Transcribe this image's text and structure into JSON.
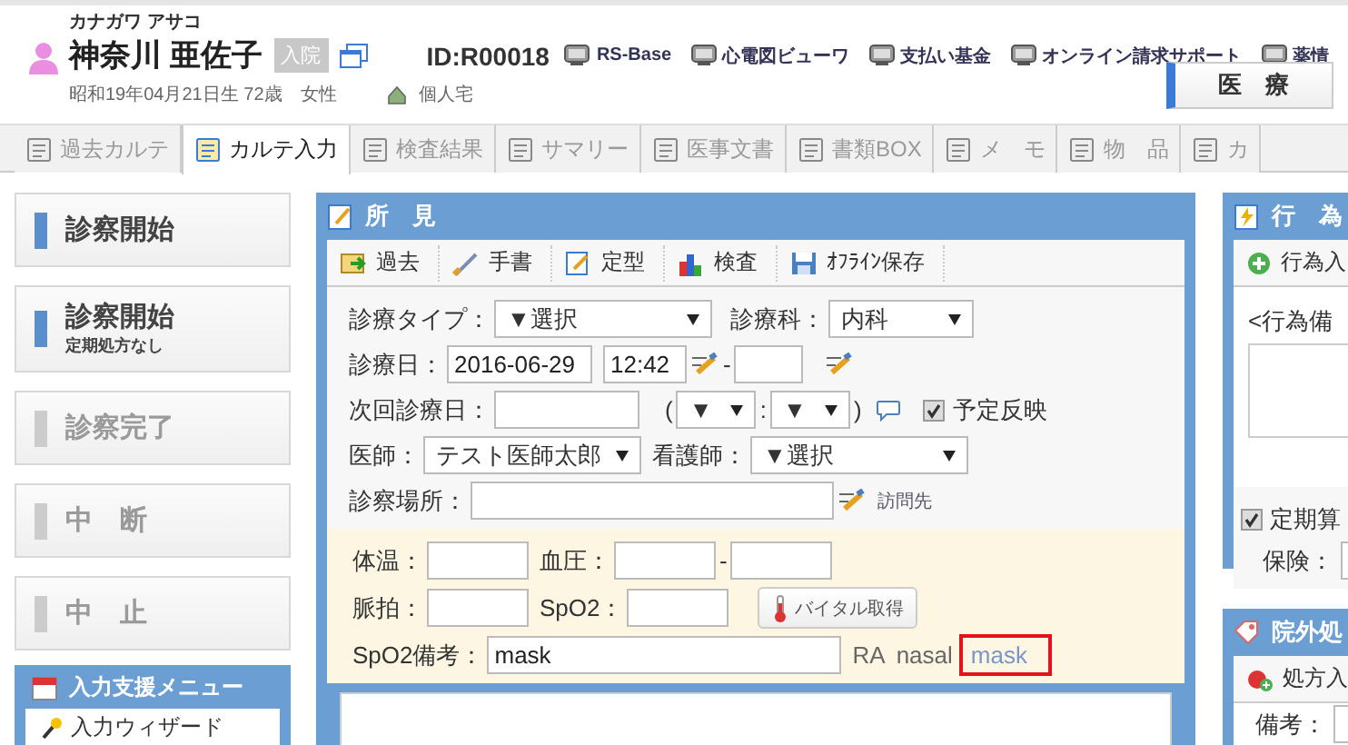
{
  "header": {
    "kana": "カナガワ アサコ",
    "name": "神奈川 亜佐子",
    "status_badge": "入院",
    "patient_id": "ID:R00018",
    "birth_info": "昭和19年04月21日生 72歳　女性",
    "residence": "個人宅",
    "links": [
      {
        "label": "RS-Base"
      },
      {
        "label": "心電図ビューワ"
      },
      {
        "label": "支払い基金"
      },
      {
        "label": "オンライン請求サポート"
      },
      {
        "label": "薬情"
      }
    ],
    "mode_button": "医　療"
  },
  "tabs": [
    {
      "label": "過去カルテ",
      "selected": false
    },
    {
      "label": "カルテ入力",
      "selected": true
    },
    {
      "label": "検査結果",
      "selected": false
    },
    {
      "label": "サマリー",
      "selected": false
    },
    {
      "label": "医事文書",
      "selected": false
    },
    {
      "label": "書類BOX",
      "selected": false
    },
    {
      "label": "メ　モ",
      "selected": false
    },
    {
      "label": "物　品",
      "selected": false
    },
    {
      "label": "カ",
      "selected": false
    }
  ],
  "left_buttons": [
    {
      "label": "診察開始",
      "disabled": false
    },
    {
      "label": "診察開始",
      "sublabel": "定期処方なし",
      "disabled": false
    },
    {
      "label": "診察完了",
      "disabled": true
    },
    {
      "label": "中　断",
      "disabled": true
    },
    {
      "label": "中　止",
      "disabled": true
    }
  ],
  "support_menu": {
    "title": "入力支援メニュー",
    "items": [
      "入力ウィザード"
    ]
  },
  "findings": {
    "title": "所　見",
    "toolbar": [
      {
        "label": "過去"
      },
      {
        "label": "手書"
      },
      {
        "label": "定型"
      },
      {
        "label": "検査"
      },
      {
        "label": "ｵﾌﾗｲﾝ保存"
      }
    ],
    "visit_type": {
      "label": "診療タイプ：",
      "value": "▼選択"
    },
    "department": {
      "label": "診療科：",
      "value": "内科"
    },
    "visit_date": {
      "label": "診療日：",
      "date": "2016-06-29",
      "time": "12:42",
      "separator": "-"
    },
    "next_visit": {
      "label": "次回診療日：",
      "open_paren": "(",
      "hour": "▼",
      "colon": ":",
      "minute": "▼",
      "close_paren": ")",
      "reflect_label": "予定反映",
      "reflect_checked": true
    },
    "doctor": {
      "label": "医師：",
      "value": "テスト医師太郎"
    },
    "nurse": {
      "label": "看護師：",
      "value": "▼選択"
    },
    "place": {
      "label": "診察場所：",
      "link": "訪問先"
    },
    "vitals": {
      "temperature_label": "体温：",
      "pressure_label": "血圧：",
      "pressure_separator": "-",
      "pulse_label": "脈拍：",
      "spo2_label": "SpO2：",
      "fetch_button": "バイタル取得",
      "note_label": "SpO2備考：",
      "note_value": "mask",
      "quick_notes": [
        {
          "label": "RA",
          "highlighted": false
        },
        {
          "label": "nasal",
          "highlighted": false
        },
        {
          "label": "mask",
          "highlighted": true
        }
      ]
    }
  },
  "actions": {
    "title": "行　為",
    "add_button": "行為入",
    "note_label": "<行為備",
    "periodic_label": "定期算",
    "periodic_checked": true,
    "insurance_label": "保険："
  },
  "prescription": {
    "title": "院外処",
    "add_button": "処方入",
    "note_label": "備考："
  }
}
